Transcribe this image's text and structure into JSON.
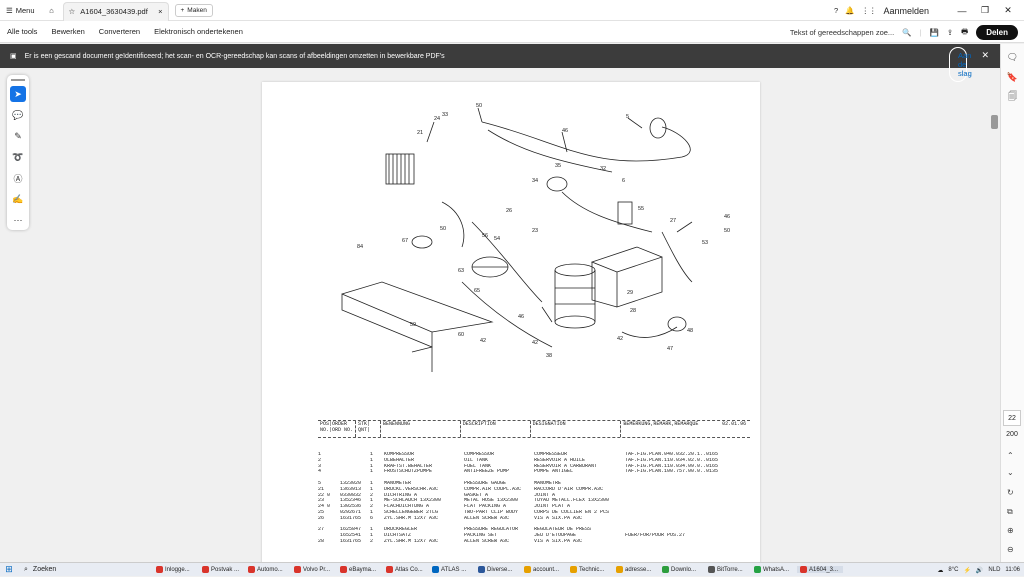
{
  "titlebar": {
    "menu_label": "Menu",
    "tab_title": "A1604_3630439.pdf",
    "new_tab_label": "Maken",
    "signin_label": "Aanmelden"
  },
  "toolbar": {
    "items": [
      "Alle tools",
      "Bewerken",
      "Converteren",
      "Elektronisch ondertekenen"
    ],
    "search_placeholder": "Tekst of gereedschappen zoe...",
    "share_label": "Delen"
  },
  "banner": {
    "message": "Er is een gescand document geïdentificeerd; het scan- en OCR-gereedschap kan scans of afbeeldingen omzetten in bewerkbare PDF's",
    "action_label": "Aan de slag"
  },
  "pager": {
    "current": "22",
    "total": "200"
  },
  "table": {
    "header": {
      "pos": "POS|ORDER\nNO.|ORD NO.",
      "qty": "STK|\nQNT|",
      "benennung": "BENENNUNG",
      "description": "DESCRIPTION",
      "designation": "DESIGNATION",
      "bemerkung": "BEMERKUNG,REMARK,REMARQUE",
      "date": "02.01.96"
    },
    "rows": [
      [
        "1",
        "",
        "1",
        "KOMPRESSOR",
        "COMPRESSOR",
        "COMPRESSEUR",
        "TAF.FIG.PLAN.040.032.20.1..0165"
      ],
      [
        "2",
        "",
        "1",
        "ÖLBEHÄLTER",
        "OIL TANK",
        "RESERVOIR A HUILE",
        "TAF.FIG.PLAN.110.034.02.0..0165"
      ],
      [
        "3",
        "",
        "1",
        "KRAFTST.BEHÄLTER",
        "FUEL TANK",
        "RESERVOIR A CARBURANT",
        "TAF.FIG.PLAN.110.034.09.0..0165"
      ],
      [
        "4",
        "",
        "1",
        "FROSTSCHUTZPUMPE",
        "ANTIFREEZE PUMP",
        "POMPE ANTIGEL",
        "TAF.FIG.PLAN.100.757.00.0..0135"
      ],
      [
        "",
        "",
        "",
        "",
        "",
        "",
        ""
      ],
      [
        "5",
        "1323020",
        "1",
        "MANOMETER",
        "PRESSURE GAUGE",
        "MANOMETRE",
        ""
      ],
      [
        "21",
        "1363913",
        "1",
        "DRUCKL.VERSCHR.A3C",
        "COMPR.AIR COUPL.A3C",
        "RACCORD D'AIR COMPR.A3C",
        ""
      ],
      [
        "22 0",
        "0330832",
        "2",
        "DICHTRING A",
        "GASKET A",
        "JOINT A",
        ""
      ],
      [
        "23",
        "1352346",
        "1",
        "ME-SCHLAUCH 13X2300",
        "METAL HOSE 13X2300",
        "TUYAU METALL.FLEX 13X2300",
        ""
      ],
      [
        "24 0",
        "1302536",
        "2",
        "FLACHDICHTUNG A",
        "FLAT PACKING A",
        "JOINT PLAT A",
        ""
      ],
      [
        "25",
        "0292671",
        "1",
        "SCHELLENGEBER 2TLG",
        "TWO-PART CLIP BODY",
        "CORPS DE COLLIER EN 2 PCS",
        ""
      ],
      [
        "26",
        "1631765",
        "6",
        "ZYL.SHR.M 12X7 A3C",
        "ALLEN SCREW A3C",
        "VIS A SIX.PA A3C",
        ""
      ],
      [
        "",
        "",
        "",
        "",
        "",
        "",
        ""
      ],
      [
        "27",
        "1625847",
        "1",
        "DRUCKREGLER",
        "PRESSURE REGULATOR",
        "REGULATEUR DE PRESS",
        ""
      ],
      [
        "",
        "1652541",
        "1",
        "DICHTSATZ",
        "PACKING SET",
        "JEU D'ETOUPAGE",
        "FUER/FOR/POUR POS.27"
      ],
      [
        "28",
        "1631765",
        "2",
        "ZYL.SHR.M 12X7 A3C",
        "ALLEN SCREW A3C",
        "VIS A SIX.PA A3C",
        ""
      ]
    ]
  },
  "taskbar": {
    "search_label": "Zoeken",
    "apps": [
      {
        "label": "Inlogge...",
        "color": "#d9342b"
      },
      {
        "label": "Postvak ...",
        "color": "#d9342b"
      },
      {
        "label": "Automo...",
        "color": "#d9342b"
      },
      {
        "label": "Volvo Pr...",
        "color": "#d9342b"
      },
      {
        "label": "eBayma...",
        "color": "#d9342b"
      },
      {
        "label": "Atlas Co...",
        "color": "#d9342b"
      },
      {
        "label": "ATLAS ...",
        "color": "#0067c0"
      },
      {
        "label": "Diverse...",
        "color": "#2b579a"
      },
      {
        "label": "account...",
        "color": "#e6a000"
      },
      {
        "label": "Technic...",
        "color": "#e6a000"
      },
      {
        "label": "adresse...",
        "color": "#e6a000"
      },
      {
        "label": "Downlo...",
        "color": "#2e9e3e"
      },
      {
        "label": "BitTorre...",
        "color": "#555555"
      },
      {
        "label": "WhatsA...",
        "color": "#25a244"
      },
      {
        "label": "A1604_3...",
        "color": "#d9342b"
      }
    ],
    "weather": "8°C",
    "lang": "NLD",
    "time": "11:06"
  }
}
